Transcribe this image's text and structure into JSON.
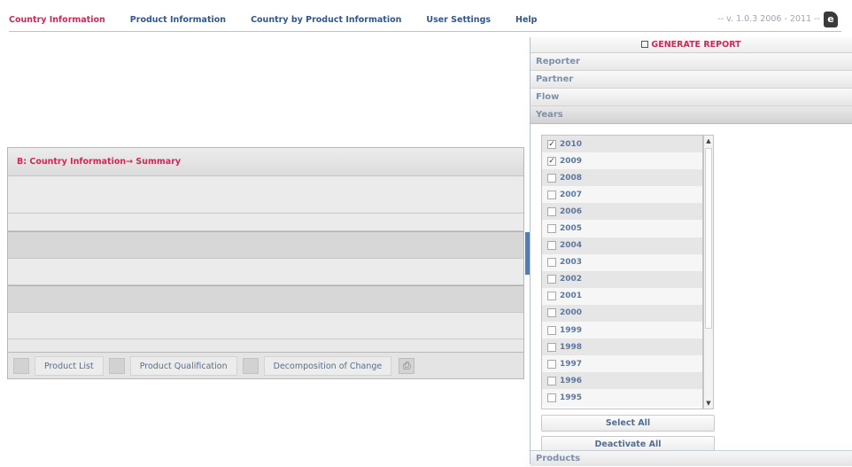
{
  "nav": {
    "items": [
      "Country Information",
      "Product Information",
      "Country by Product Information",
      "User Settings",
      "Help"
    ],
    "version": "-- v. 1.0.3 2006 - 2011 --"
  },
  "left_panel": {
    "title": "B: Country Information→ Summary",
    "buttons": [
      "Product List",
      "Product Qualification",
      "Decomposition of Change"
    ]
  },
  "right_panel": {
    "generate_label": "GENERATE REPORT",
    "sections": [
      "Reporter",
      "Partner",
      "Flow",
      "Years"
    ],
    "years": [
      {
        "year": "2010",
        "checked": true
      },
      {
        "year": "2009",
        "checked": true
      },
      {
        "year": "2008",
        "checked": false
      },
      {
        "year": "2007",
        "checked": false
      },
      {
        "year": "2006",
        "checked": false
      },
      {
        "year": "2005",
        "checked": false
      },
      {
        "year": "2004",
        "checked": false
      },
      {
        "year": "2003",
        "checked": false
      },
      {
        "year": "2002",
        "checked": false
      },
      {
        "year": "2001",
        "checked": false
      },
      {
        "year": "2000",
        "checked": false
      },
      {
        "year": "1999",
        "checked": false
      },
      {
        "year": "1998",
        "checked": false
      },
      {
        "year": "1997",
        "checked": false
      },
      {
        "year": "1996",
        "checked": false
      },
      {
        "year": "1995",
        "checked": false
      }
    ],
    "select_all": "Select All",
    "deactivate_all": "Deactivate All",
    "products": "Products"
  },
  "colors": {
    "accent": "#cc2a52",
    "nav": "#34558b",
    "splitter": "#4c7fb8"
  }
}
